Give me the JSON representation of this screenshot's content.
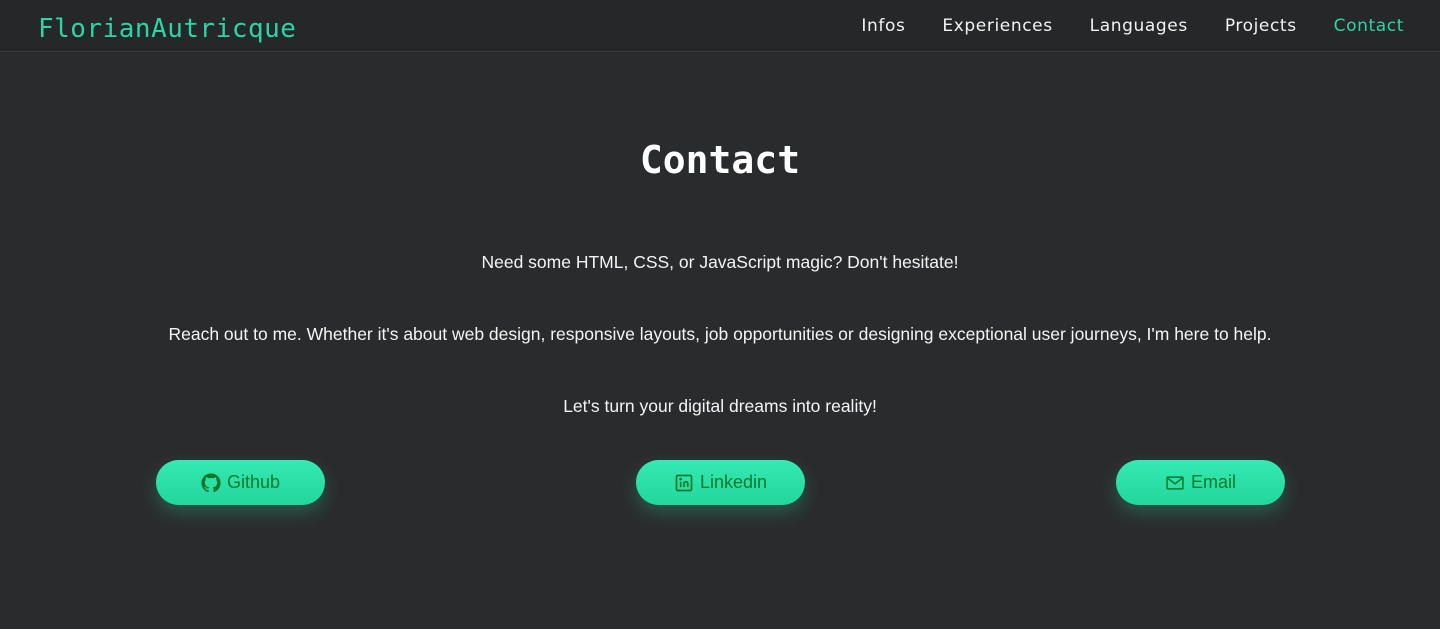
{
  "header": {
    "brand": "FlorianAutricque",
    "nav": [
      {
        "label": "Infos",
        "active": false
      },
      {
        "label": "Experiences",
        "active": false
      },
      {
        "label": "Languages",
        "active": false
      },
      {
        "label": "Projects",
        "active": false
      },
      {
        "label": "Contact",
        "active": true
      }
    ]
  },
  "main": {
    "title": "Contact",
    "paragraphs": [
      "Need some HTML, CSS, or JavaScript magic? Don't hesitate!",
      "Reach out to me. Whether it's about web design, responsive layouts, job opportunities or designing exceptional user journeys, I'm here to help.",
      "Let's turn your digital dreams into reality!"
    ],
    "buttons": [
      {
        "label": "Github",
        "icon": "github-icon"
      },
      {
        "label": "Linkedin",
        "icon": "linkedin-icon"
      },
      {
        "label": "Email",
        "icon": "mail-icon"
      }
    ]
  },
  "colors": {
    "background": "#2a2b2c",
    "accent": "#2dd4a6",
    "button_fill": "#2ee3aa",
    "button_text": "#0a7a2a"
  }
}
